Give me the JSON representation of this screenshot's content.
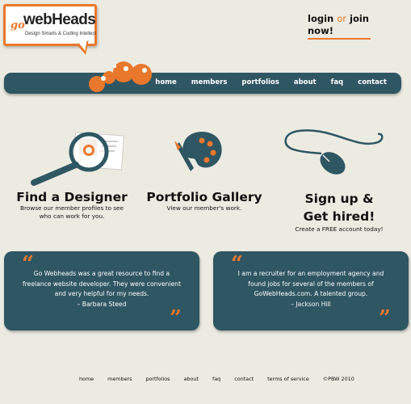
{
  "logo": {
    "go": "go",
    "name": "webHeads",
    "tagline": "Design Smarts & Coding Intellect"
  },
  "login": {
    "login": "login",
    "or": "or",
    "join": "join",
    "now": "now!"
  },
  "nav": [
    "home",
    "members",
    "portfolios",
    "about",
    "faq",
    "contact"
  ],
  "features": [
    {
      "title": "Find a Designer",
      "desc1": "Browse our member profiles to see",
      "desc2": "who can work for you."
    },
    {
      "title": "Portfolio Gallery",
      "desc1": "View our member's work."
    },
    {
      "title1": "Sign up &",
      "title2": "Get hired!",
      "desc1": "Create a FREE account today!"
    }
  ],
  "quotes": [
    {
      "line1": "Go Webheads was a great resource to find a",
      "line2": "freelance website developer. They were convenient",
      "line3": "and very helpful for my needs.",
      "line4": "– Barbara Steed"
    },
    {
      "line1": "I am a recruiter for an employment agency and",
      "line2": "found jobs for several of the members of",
      "line3": "GoWebHeads.com. A talented group.",
      "line4": "– Jackson Hill"
    }
  ],
  "footer": [
    "home",
    "members",
    "portfolios",
    "about",
    "faq",
    "contact",
    "terms of service"
  ],
  "copyright": "©PBW 2010",
  "colors": {
    "accent": "#e9782c",
    "teal": "#2f5663",
    "background": "#ecebe2"
  }
}
